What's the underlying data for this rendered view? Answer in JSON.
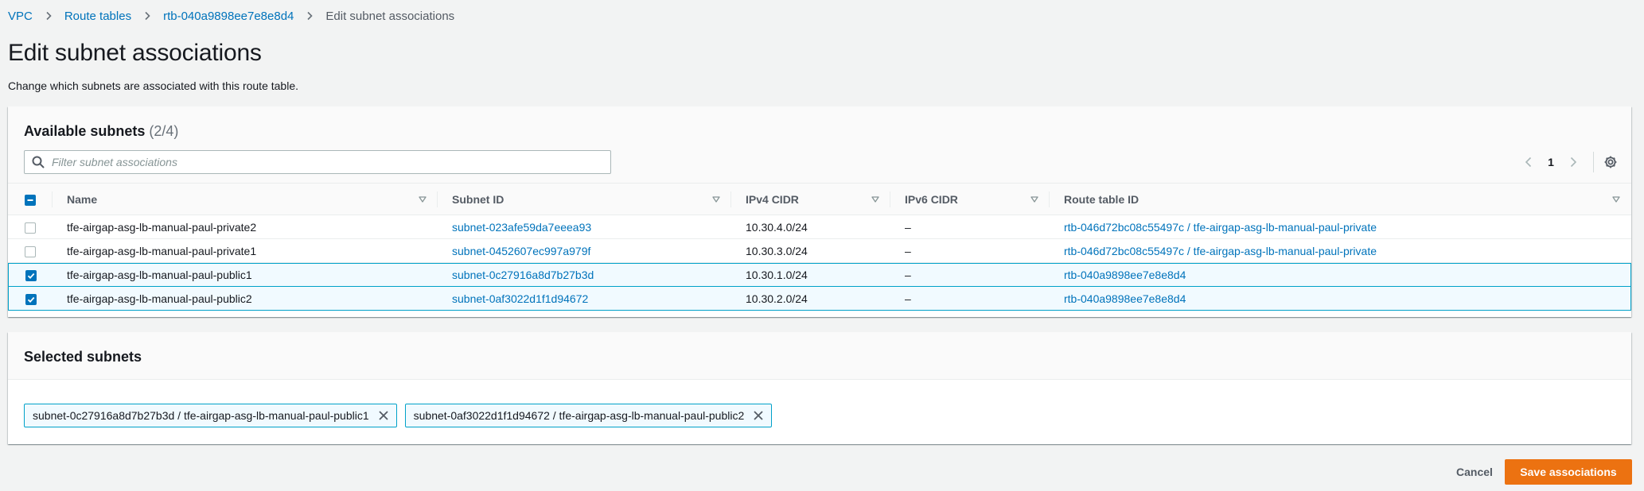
{
  "breadcrumb": {
    "items": [
      "VPC",
      "Route tables",
      "rtb-040a9898ee7e8e8d4"
    ],
    "current": "Edit subnet associations"
  },
  "page": {
    "title": "Edit subnet associations",
    "description": "Change which subnets are associated with this route table."
  },
  "available": {
    "title": "Available subnets",
    "counter": "(2/4)",
    "filter_placeholder": "Filter subnet associations",
    "page_number": "1",
    "columns": [
      "Name",
      "Subnet ID",
      "IPv4 CIDR",
      "IPv6 CIDR",
      "Route table ID"
    ],
    "rows": [
      {
        "selected": false,
        "name": "tfe-airgap-asg-lb-manual-paul-private2",
        "subnet_id": "subnet-023afe59da7eeea93",
        "ipv4": "10.30.4.0/24",
        "ipv6": "–",
        "route_table": "rtb-046d72bc08c55497c / tfe-airgap-asg-lb-manual-paul-private"
      },
      {
        "selected": false,
        "name": "tfe-airgap-asg-lb-manual-paul-private1",
        "subnet_id": "subnet-0452607ec997a979f",
        "ipv4": "10.30.3.0/24",
        "ipv6": "–",
        "route_table": "rtb-046d72bc08c55497c / tfe-airgap-asg-lb-manual-paul-private"
      },
      {
        "selected": true,
        "name": "tfe-airgap-asg-lb-manual-paul-public1",
        "subnet_id": "subnet-0c27916a8d7b27b3d",
        "ipv4": "10.30.1.0/24",
        "ipv6": "–",
        "route_table": "rtb-040a9898ee7e8e8d4"
      },
      {
        "selected": true,
        "name": "tfe-airgap-asg-lb-manual-paul-public2",
        "subnet_id": "subnet-0af3022d1f1d94672",
        "ipv4": "10.30.2.0/24",
        "ipv6": "–",
        "route_table": "rtb-040a9898ee7e8e8d4"
      }
    ]
  },
  "selected": {
    "title": "Selected subnets",
    "tokens": [
      "subnet-0c27916a8d7b27b3d / tfe-airgap-asg-lb-manual-paul-public1",
      "subnet-0af3022d1f1d94672 / tfe-airgap-asg-lb-manual-paul-public2"
    ]
  },
  "footer": {
    "cancel_label": "Cancel",
    "save_label": "Save associations"
  },
  "colors": {
    "link": "#0073bb",
    "primary_button": "#ec7211",
    "selection_border": "#00a1c9",
    "selection_bg": "#f1faff"
  }
}
